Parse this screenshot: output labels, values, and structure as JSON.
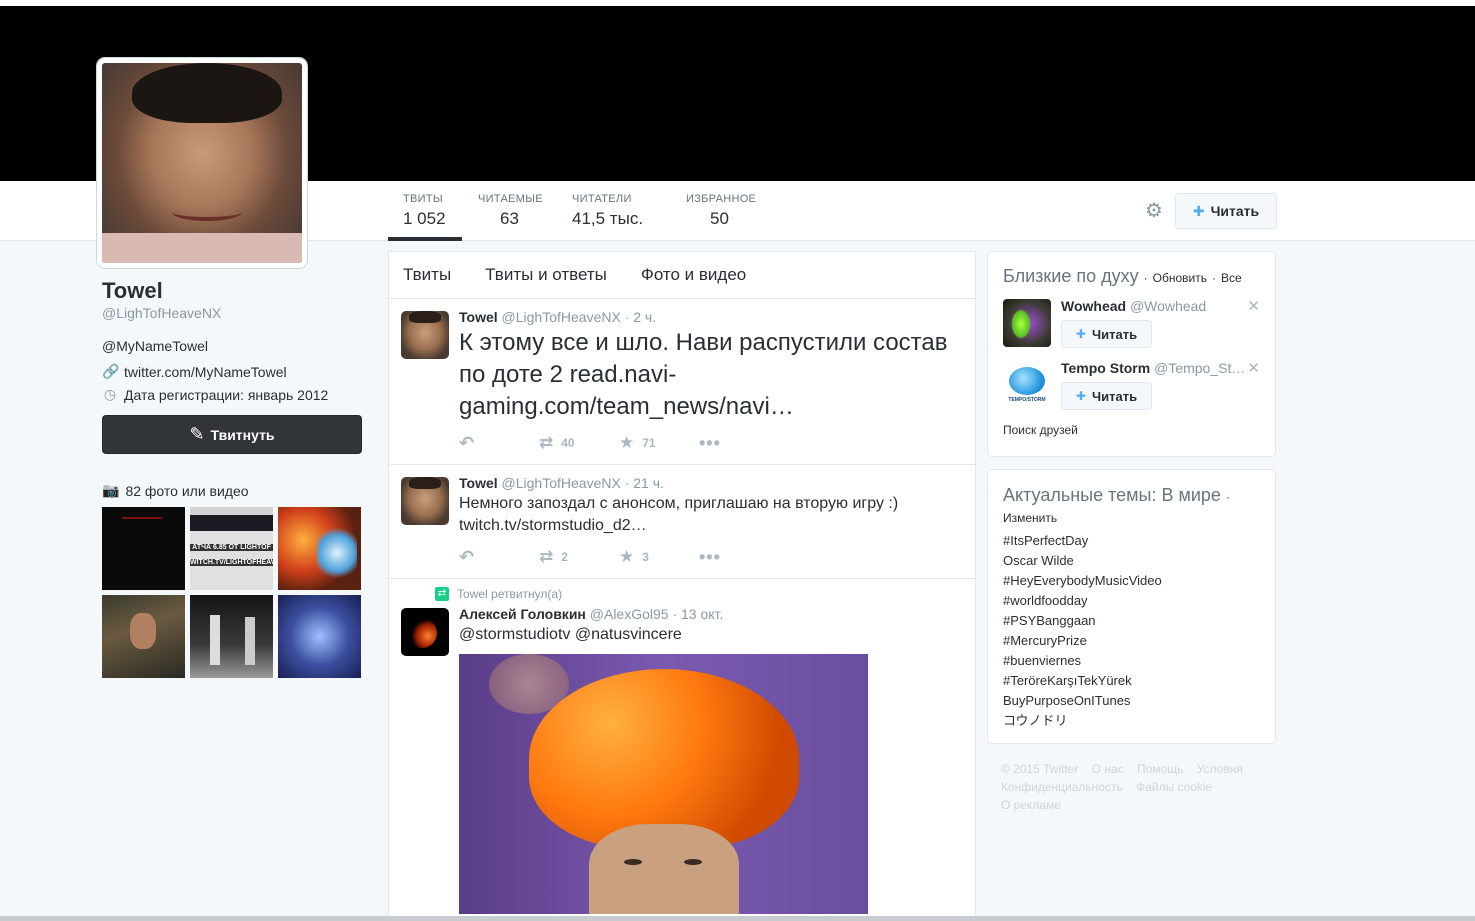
{
  "stats": [
    {
      "label": "ТВИТЫ",
      "value": "1 052"
    },
    {
      "label": "ЧИТАЕМЫЕ",
      "value": "63"
    },
    {
      "label": "ЧИТАТЕЛИ",
      "value": "41,5 тыс."
    },
    {
      "label": "ИЗБРАННОЕ",
      "value": "50"
    }
  ],
  "follow_label": "Читать",
  "profile": {
    "name": "Towel",
    "handle": "@LighTofHeaveNX",
    "bio": "@MyNameTowel",
    "url": "twitter.com/MyNameTowel",
    "joined": "Дата регистрации: январь 2012",
    "tweet_button": "Твитнуть",
    "photos_label": "82 фото или видео",
    "thumb_text_1": "АТЧА 6.85 ОТ LIGHTOF",
    "thumb_text_2": "WITCH.TV/LIGHTOFHEAVEN"
  },
  "feed_tabs": [
    "Твиты",
    "Твиты и ответы",
    "Фото и видео"
  ],
  "tweets": [
    {
      "name": "Towel",
      "handle": "@LighTofHeaveNX",
      "time": "· 2 ч.",
      "text": "К этому все и шло. Нави распустили состав по доте 2 read.navi-gaming.com/team_news/navi…",
      "retweets": "40",
      "favorites": "71"
    },
    {
      "name": "Towel",
      "handle": "@LighTofHeaveNX",
      "time": "· 21 ч.",
      "text": "Немного запоздал с анонсом, приглашаю на вторую игру :) twitch.tv/stormstudio_d2…",
      "retweets": "2",
      "favorites": "3"
    },
    {
      "retweet_note": "Towel ретвитнул(а)",
      "name": "Алексей Головкин",
      "handle": "@AlexGol95",
      "time": "· 13 окт.",
      "text": "@stormstudiotv @natusvincere"
    }
  ],
  "who_to_follow": {
    "title": "Близкие по духу",
    "refresh": "Обновить",
    "separator": "·",
    "all": "Все",
    "items": [
      {
        "name": "Wowhead",
        "handle": "@Wowhead"
      },
      {
        "name": "Tempo Storm",
        "handle": "@Tempo_St…",
        "brand": "TEMPO/STORM"
      }
    ],
    "follow_label": "Читать",
    "find_friends": "Поиск друзей"
  },
  "trends": {
    "title": "Актуальные темы: В мире",
    "separator": "·",
    "change": "Изменить",
    "items": [
      "#ItsPerfectDay",
      "Oscar Wilde",
      "#HeyEverybodyMusicVideo",
      "#worldfoodday",
      "#PSYBanggaan",
      "#MercuryPrize",
      "#buenviernes",
      "#TeröreKarşıTekYürek",
      "BuyPurposeOnITunes",
      "コウノドリ"
    ]
  },
  "footer": {
    "copyright": "© 2015 Twitter",
    "links": [
      "О нас",
      "Помощь",
      "Условия",
      "Конфиденциальность",
      "Файлы cookie",
      "О рекламе"
    ]
  }
}
